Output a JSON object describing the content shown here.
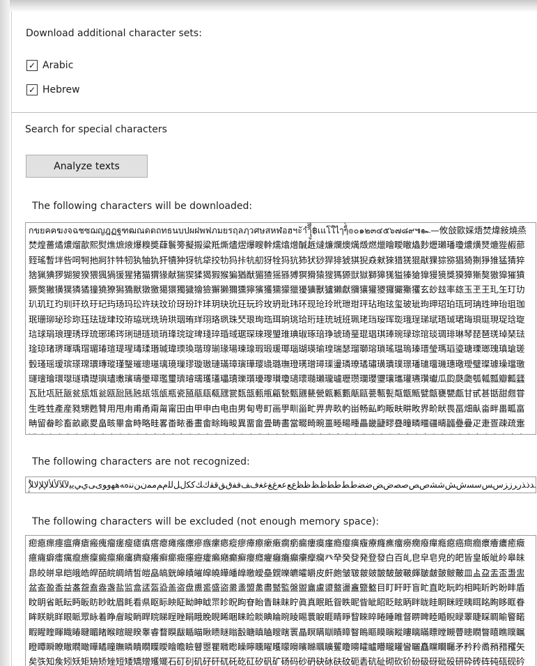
{
  "download_section": {
    "title": "Download additional character sets:",
    "charsets": [
      {
        "label": "Arabic",
        "checked": true
      },
      {
        "label": "Hebrew",
        "checked": true
      }
    ]
  },
  "search_section": {
    "title": "Search for special characters",
    "analyze_button": "Analyze texts"
  },
  "downloaded": {
    "label": "The following characters will be downloaded:",
    "characters": "กขยคฅฆงจฉชซฌญฎฏฐฑฒณดตถทธนบปผฝพฟภมยรฤลฦวศษสหฬอฮฯะัาำิีึืฺุู฿เแโใไๅๆ็่้๊๋์ํ๎๏๐๑๒๓๔๕๖๗๘๙๚๛—攸敆歐婇焐焚煒敍燒烝焚煌薔燏燶熘歖熙熨燋熫焲爆糗奬蕼鬟篣擬摋粱羝燍燼熤爆瞍龫燸熻熷醎䞣燵燫爛燠燤燬燃爉瞺瞹瞮爞麨爏瓎璠瓊燶熿燹熝狴赮蔀臸瑤暫坢呰呞牱扡牁犿牪牣犱牰犰犴犢狆犽牨牮挍牞犸拤牨舠犽牷犸犺犻犾猀猂猅猇猉猊猋猌猍猎猐猑猒猓猔猕猖猗猘猙猚猛猜猝猞猟猠猡猢猣猤猥猦猧猨猩猪猫猬猭献猯猰猱猲猳猴猵猶猷猸猹猺猻猼猽猾猿獀獁獂獃獄獅獆獇獈獉獊獋獌獍獎獏獐獑獒獓獔獕獖獗獘獙獚獛獜獝獞獟獠獡獢獣獤獥獦獧獨獩獪獫獬獭獮獯獰獱獲獳獴獵獶獷獸獹獺獻獼獽獾獿玀玁玂玃玄玅玆率玈玉玊王玌玍玎玏玐玑玒玓玔玕玖玗玘玙玚玛玜玝玞玟玠玡玢玣玤玥玦玧玨玩玪玫玬玭玮环现玱玲玳玴玵玶玷玸玹玺玻玼玽玾玿珀珁珂珃珄珅珆珇珈珉珊珋珌珍珎珏珐珑珒珓珔珕珖珗珘珙珚珛珜珝珞珟珠珡珢珣珤珥珦珧珨珩珪珫珬班珮珯珰珱珲珳珴珵珶珷珸珹珺珻珼珽現珿琀琁琂球琄琅理琇琈琉琊琋琌琍琎琏琐琑琒琓琔琕琖琗琘琙琚琛琜琝琞琟琠琡琢琣琤琥琦琧琨琩琪琫琬琭琮琯琰琱琲琳琴琵琶琷琸琹琺琻琼琽琾琿瑀瑁瑂瑃瑄瑅瑆瑇瑈瑉瑊瑋瑌瑍瑎瑏瑐瑑瑒瑓瑔瑕瑖瑗瑘瑙瑚瑛瑜瑝瑞瑟瑠瑡瑢瑣瑤瑥瑦瑧瑨瑩瑪瑫瑬瑭瑮瑯瑰瑱瑲瑳瑴瑵瑶瑷瑸瑹瑺瑻瑼瑽瑾瑿璀璁璂璃璄璅璆璇璈璉璊璋璌璍璎璏璐璑璒璓璔璕璖璗璘璙璚璛璜璝璞璟璠璡璢璣璤璥璦璧璨璩璪璫璬璭璮璯環璱璲璳璴璵璶璷璸璹璺璻璼璽璾璿瓀瓁瓂瓃瓄瓅瓆瓇瓈瓉瓊瓋瓌瓍瓎瓏瓐瓑瓒瓓瓔瓕瓖瓗瓘瓙瓚瓛瓜瓝瓞瓟瓠瓡瓢瓣瓤瓥瓦瓧瓨瓩瓪瓫瓬瓭瓮瓯瓰瓱瓲瓳瓴瓵瓶瓷瓸瓹瓺瓻瓼瓽瓾瓿甀甁甂甃甄甅甆甇甈甉甊甋甌甍甎甏甐甑甒甓甔甕甖甗甘甙甚甛甜甝甞生甠甡產産甤甥甦甧用甩甪甫甬甭甮甯田由甲申甴电甶男甸甹町画甼甽甾甿畀畁畂畃畄畅畆畇畈畉畊畋界畍畎畏畐畑畒畓畔畕畖畗畘留畚畛畜畝畞畟畠畡畢畣畤略畦畧畨畩番畫畬畭畮畯異畱畲畳畴畵當畷畸畹畺畻畼畽畾畿疀疁疂疃疄疅疆疇疈疉疊疋疌疍疎疏疐疑疒疓疔疕疖疗疘疙疚疛疜疝疞疟疠疡疢疣疤疥疦疧疨疩疪疫疬疭疮疯疰疱疲疳疴疵疶疷疸疹疺疻疼疽疾疿痀痁痂痃痄病痆症痈痉痊痋痌痍痎痏痐痑痒痓痔痕痖痗痘痙痚痛痜痝痞痟痠痡痢痣痤痥痦痧痨痩痪痫痬痭痮痯痰痱痲痳痴痵痶痷痸痹痺痻痼痽痾痿瘀瘁瘂瘃瘄瘅瘆瘇瘈瘉瘊瘋瘌瘍瘎瘏瘐瘑瘒瘓瘔瘕瘖瘗瘘瘙瘚瘛瘜瘝瘞瘟瘠瘡瘢瘣瘤瘥瘦瘧瘨瘩瘪瘫瘬瘭瘮瘯瘰瘱瘲瘳瘴瘵瘶瘷瘸瘹瘺瘻瘼瘽瘾瘿癀癁療癃癄癅癆癇癈癉癊癋癌癍癎癏癐癑癒癓癔癕癖癗癘癙癚癛癜癝癞癟癠癡癢癣癤癥癦癧癨癩癪癫癬癭癮癯癰癱癲癳癴癵癶癷癸癹発登發白百癿皀皁皂皃的皅皆皇皈皉皊皋皌皍皎皏皐皑皒皓皔皕皖皗皘皙皚皛皜皝皞皟皠皡皢皣皤皥皦皧皨皩皪皫皬皭皮皯皰皱皲皳皴皵皶皷皸皹皺皻皼皽皾皿盀盁盂盃盄盅盆盇盈盉益盋盌盍盎盏盐监盒盓盔盕盖盗盘盙盚盛盜盝盞盟盠盡盢監盤盥盦盧盨盩盪盫盬盭目盯盰盱盲盳直盵盶盷相盹盺盻盼盽盾盿眀省眂眃眄眅眆眇眈眉眊看県眍眎眏眐眑眒眓眔眕眖眗眘眙眚眛眜眝眞真眠眡眢眣眤眥眦眧眨眩眪眫眬眭眮眯眰眱眲眳眴眵眶眷眸眹眺眻眼眽眾眿着睁睂睃睄睅睆睇睈睉睊睋睌睍睎睏睐睑睒睓睔睕睖睗睘睙睚睛睜睝睞睟睠睡睢督睤睥睦睧睨睩睪睫睬睭睮睯睰睱睲睳睴睵睶睷睸睹睺睻睼睽睾睿瞀瞁瞂瞃瞄瞅瞆瞇瞈瞉瞊瞋瞌瞍瞎瞏瞐瞑瞒瞓瞔瞕瞖瞗瞘瞙瞚瞛瞜瞝瞞瞟瞠瞡瞢瞣瞤瞥瞦瞧瞨瞩瞪瞫瞬瞭瞮瞯瞰瞱瞲瞳瞴瞵瞶瞷瞸瞹瞺瞻瞼瞽瞾瞿矀矁矂矃矄矅矆矇矈矉矊矋矌矍矎矏矐矑矒矓矔矕矖矗矘矙矚矛矜矝矞矟矠矡矢矣矤知矦矧矨矩矪矫矬短矮矯矰矱矲石矴矵矶矷矸矹矺矻矼矽矾矿砀码砂砃砄砅砆砇砈砉砊砋砌砍砎砏砐砑砒砓研砕砖砗砘砙砚砛砜砝砞砟砠砡砢砣砤砥砦砧砨砩砪砫砬砭砮砯砰砱砲砳破砵砶砷砸砹砺砻砼砽砾砿"
  },
  "not_recognized": {
    "label": "The following characters are not recognized:",
    "characters": "ۭ۪ۨۡ۠ۤ۫ۯۙۚۢۧۜۗ۬ۘ۩ۦۥۣۖ۟۞ۛ۝ﮮﮯﺆﺉﺊﺋﺌﺍﺎﺏﺐﺑﺒﺓﺔﺕﺖﺗﺘﺙﺚﺛﺜﺝﺞﺟﺠﺡﺢﺣﺤﺥﺦﺧﺨﺩﺪﺫﺬﺭﺮﺯﺰﺱﺲﺳﺴﺵﺶﺷﺸﺹﺺﺻﺼﺽﺾﺿﻀﻁﻂﻃﻄﻅﻆﻇﻈﻉﻊﻋﻌﻍﻎﻏﻐﻑﻒﻓﻔﻕﻖﻗﻘﻙﻚﻛﻜﻝﻞﻟﻠﻡﻢﻣﻤﻥﻦﻧﻨﻩﻪﻫﻬﻭﻮﻯﻰﻱﻲﻳﻴﻵﻶﻷﻸﻹﻺﻻﻼ"
  },
  "excluded": {
    "label": "The following characters will be excluded (not enough memory space):",
    "characters": "瘛瘜瘝瘞瘟瘠瘡瘢瘣瘤瘥瘦瘧瘨瘩瘪瘫瘬瘭瘮瘯瘰瘱瘲瘳瘴瘵瘶瘷瘸瘹瘺瘻瘼瘽瘾瘿癀癁療癃癄癅癆癇癈癉癊癋癌癍癎癏癐癑癒癓癔癕癖癗癘癙癚癛癜癝癞癟癠癡癢癣癤癥癦癧癨癩癪癫癬癭癮癯癰癱癲癳癴癵癶癷癸癹発登發白百癿皀皁皂皃的皅皆皇皈皉皊皋皌皍皎皏皐皑皒皓皔皕皖皗皘皙皚皛皜皝皞皟皠皡皢皣皤皥皦皧皨皩皪皫皬皭皮皯皰皱皲皳皴皵皶皷皸皹皺皻皼皽皾皿盀盁盂盃盄盅盆盇盈盉益盋盌盍盎盏盐监盒盓盔盕盖盗盘盙盚盛盜盝盞盟盠盡盢監盤盥盦盧盨盩盪盫盬盭目盯盰盱盲盳直盵盶盷相盹盺盻盼盽盾盿眀省眂眃眄眅眆眇眈眉眊看県眍眎眏眐眑眒眓眔眕眖眗眘眙眚眛眜眝眞真眠眡眢眣眤眥眦眧眨眩眪眫眬眭眮眯眰眱眲眳眴眵眶眷眸眹眺眻眼眽眾眿着睁睂睃睄睅睆睇睈睉睊睋睌睍睎睏睐睑睒睓睔睕睖睗睘睙睚睛睜睝睞睟睠睡睢督睤睥睦睧睨睩睪睫睬睭睮睯睰睱睲睳睴睵睶睷睸睹睺睻睼睽睾睿瞀瞁瞂瞃瞄瞅瞆瞇瞈瞉瞊瞋瞌瞍瞎瞏瞐瞑瞒瞓瞔瞕瞖瞗瞘瞙瞚瞛瞜瞝瞞瞟瞠瞡瞢瞣瞤瞥瞦瞧瞨瞩瞪瞫瞬瞭瞮瞯瞰瞱瞲瞳瞴瞵瞶瞷瞸瞹瞺瞻瞼瞽瞾瞿矀矁矂矃矄矅矆矇矈矉矊矋矌矍矎矏矐矑矒矓矔矕矖矗矘矙矚矛矜矝矞矟矠矡矢矣矤知矦矧矨矩矪矫矬短矮矯矰矱矲石矴矵矶矷矸矹矺矻矼矽矾矿砀码砂砃砄砅砆砇砈砉砊砋砌砍砎砏砐砑砒砓研砕砖砗砘砙砚砛砜砝砞砟砠砡砢砣砤砥砦砧砨砩"
  }
}
